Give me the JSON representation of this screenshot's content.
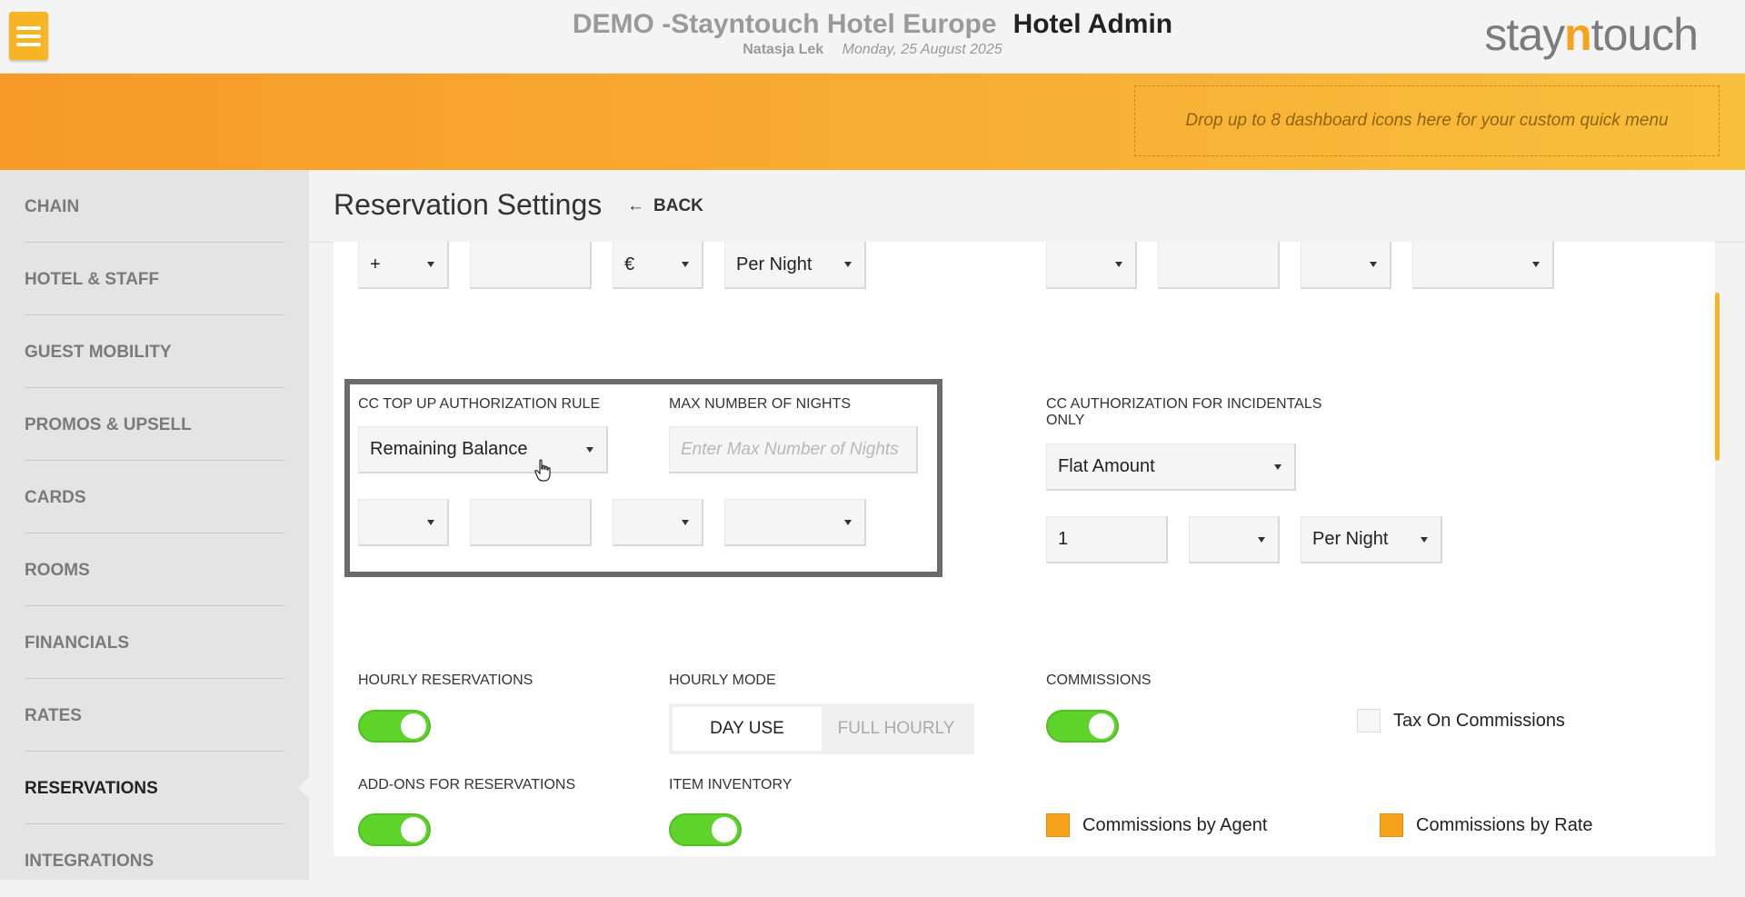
{
  "header": {
    "hotel_name": "DEMO -Stayntouch Hotel Europe",
    "app_name": "Hotel Admin",
    "user": "Natasja Lek",
    "date": "Monday, 25 August 2025",
    "logo_pre": "stay",
    "logo_n": "n",
    "logo_post": "touch",
    "brand_color": "#f7a21b"
  },
  "quickmenu": {
    "dropzone_text": "Drop up to 8 dashboard icons here for your custom quick menu"
  },
  "sidebar": {
    "items": [
      {
        "label": "CHAIN"
      },
      {
        "label": "HOTEL & STAFF"
      },
      {
        "label": "GUEST MOBILITY"
      },
      {
        "label": "PROMOS & UPSELL"
      },
      {
        "label": "CARDS"
      },
      {
        "label": "ROOMS"
      },
      {
        "label": "FINANCIALS"
      },
      {
        "label": "RATES"
      },
      {
        "label": "RESERVATIONS",
        "active": true
      },
      {
        "label": "INTEGRATIONS"
      }
    ]
  },
  "page": {
    "title": "Reservation Settings",
    "back_label": "BACK"
  },
  "top_row": {
    "operator": "+",
    "amount": "",
    "currency": "€",
    "period": "Per Night",
    "right_sel1": "",
    "right_amount": "",
    "right_sel2": "",
    "right_sel3": ""
  },
  "cc_topup": {
    "label": "CC TOP UP AUTHORIZATION RULE",
    "value": "Remaining Balance",
    "max_nights_label": "MAX NUMBER OF NIGHTS",
    "max_nights_placeholder": "Enter Max Number of Nights",
    "row2_sel1": "",
    "row2_amount": "",
    "row2_sel2": "",
    "row2_sel3": ""
  },
  "cc_incidentals": {
    "label": "CC AUTHORIZATION FOR INCIDENTALS ONLY",
    "value": "Flat Amount",
    "amount": "1",
    "currency": "",
    "period": "Per Night"
  },
  "hourly": {
    "reservations_label": "HOURLY RESERVATIONS",
    "reservations_on": true,
    "mode_label": "HOURLY MODE",
    "mode_options": [
      "DAY USE",
      "FULL HOURLY"
    ],
    "mode_selected": "DAY USE"
  },
  "commissions": {
    "label": "COMMISSIONS",
    "on": true,
    "tax_label": "Tax On Commissions",
    "tax_checked": false,
    "by_agent_label": "Commissions by Agent",
    "by_agent_checked": true,
    "by_rate_label": "Commissions by Rate",
    "by_rate_checked": true
  },
  "addons": {
    "label": "ADD-ONS FOR RESERVATIONS",
    "on": true,
    "inventory_label": "ITEM INVENTORY",
    "inventory_on": true
  }
}
